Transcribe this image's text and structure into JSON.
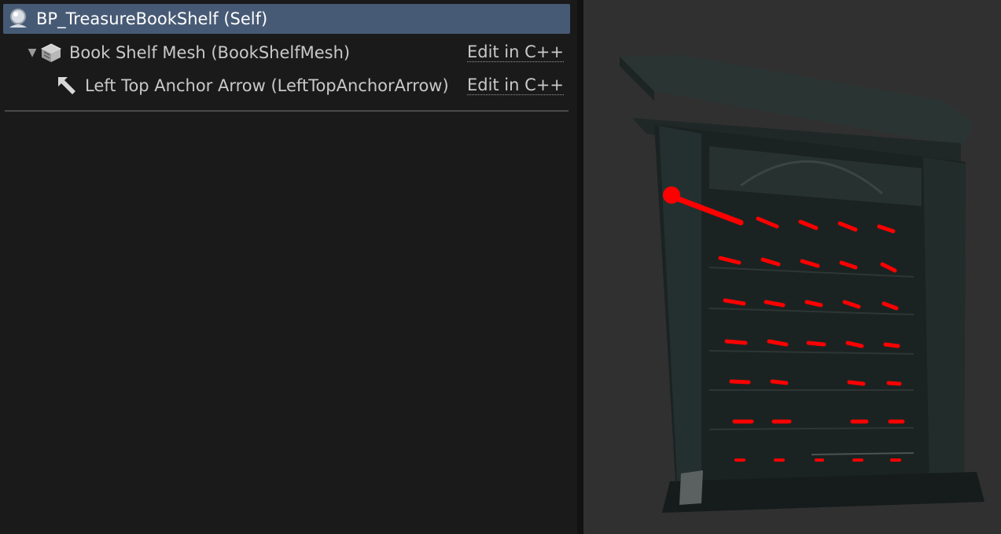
{
  "components_panel": {
    "rows": [
      {
        "label": "BP_TreasureBookShelf (Self)",
        "icon": "blueprint-self-icon",
        "selected": true
      },
      {
        "label": "Book Shelf Mesh (BookShelfMesh)",
        "icon": "static-mesh-icon",
        "expanded": true,
        "action": "Edit in C++"
      },
      {
        "label": "Left Top Anchor Arrow (LeftTopAnchorArrow)",
        "icon": "arrow-component-icon",
        "action": "Edit in C++"
      }
    ]
  },
  "viewport": {
    "object": "bookshelf-mesh",
    "arrow_color": "#ff0000",
    "background": "#303030"
  }
}
